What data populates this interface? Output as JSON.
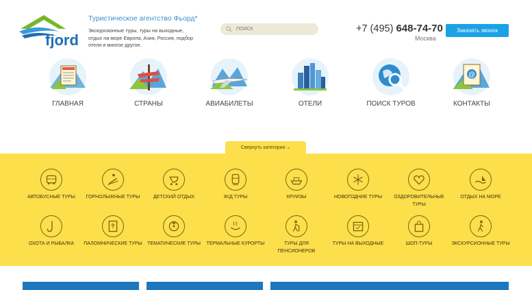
{
  "header": {
    "agency_title": "Туристическое агентство Фьорд*",
    "agency_desc": "Экскурсионные туры, туры на выходные, отдых на море Европа, Азия, Россия, подбор отеля и многое другое.",
    "logo_text": "fjord",
    "search_placeholder": "ПОИСК",
    "phone_prefix": "+7 (495)",
    "phone_number": "648-74-70",
    "city": "Москва",
    "callback_label": "Заказать звонок"
  },
  "nav": [
    {
      "label": "ГЛАВНАЯ"
    },
    {
      "label": "СТРАНЫ"
    },
    {
      "label": "АВИАБИЛЕТЫ"
    },
    {
      "label": "ОТЕЛИ"
    },
    {
      "label": "ПОИСК ТУРОВ"
    },
    {
      "label": "КОНТАКТЫ"
    }
  ],
  "categories": {
    "toggle_label": "Свернуть категории",
    "items": [
      {
        "label": "АВТОБУСНЫЕ ТУРЫ",
        "icon": "bus-icon"
      },
      {
        "label": "ГОРНОЛЫЖНЫЕ ТУРЫ",
        "icon": "ski-icon"
      },
      {
        "label": "ДЕТСКИЙ ОТДЫХ",
        "icon": "stroller-icon"
      },
      {
        "label": "Ж/Д ТУРЫ",
        "icon": "train-icon"
      },
      {
        "label": "КРУИЗЫ",
        "icon": "ship-icon"
      },
      {
        "label": "НОВОГОДНИЕ ТУРЫ",
        "icon": "snowflake-icon"
      },
      {
        "label": "ОЗДОРОВИТЕЛЬНЫЕ ТУРЫ",
        "icon": "heart-icon"
      },
      {
        "label": "ОТДЫХ НА МОРЕ",
        "icon": "sea-icon"
      },
      {
        "label": "ОХОТА И РЫБАЛКА",
        "icon": "fishhook-icon"
      },
      {
        "label": "ПАЛОМНИЧЕСКИЕ ТУРЫ",
        "icon": "bible-icon"
      },
      {
        "label": "ТЕМАТИЧЕСКИЕ ТУРЫ",
        "icon": "radiation-icon"
      },
      {
        "label": "ТЕРМАЛЬНЫЕ КУРОРТЫ",
        "icon": "spa-icon"
      },
      {
        "label": "ТУРЫ ДЛЯ ПЕНСИОНЕРОВ",
        "icon": "walking-cane-icon"
      },
      {
        "label": "ТУРЫ НА ВЫХОДНЫЕ",
        "icon": "calendar-icon"
      },
      {
        "label": "ШОП-ТУРЫ",
        "icon": "shopping-bag-icon"
      },
      {
        "label": "ЭКСКУРСИОННЫЕ ТУРЫ",
        "icon": "hiker-icon"
      }
    ]
  },
  "colors": {
    "accent_blue": "#1aa2e6",
    "category_yellow": "#fcdf4a",
    "card_blue": "#1c77bf"
  }
}
